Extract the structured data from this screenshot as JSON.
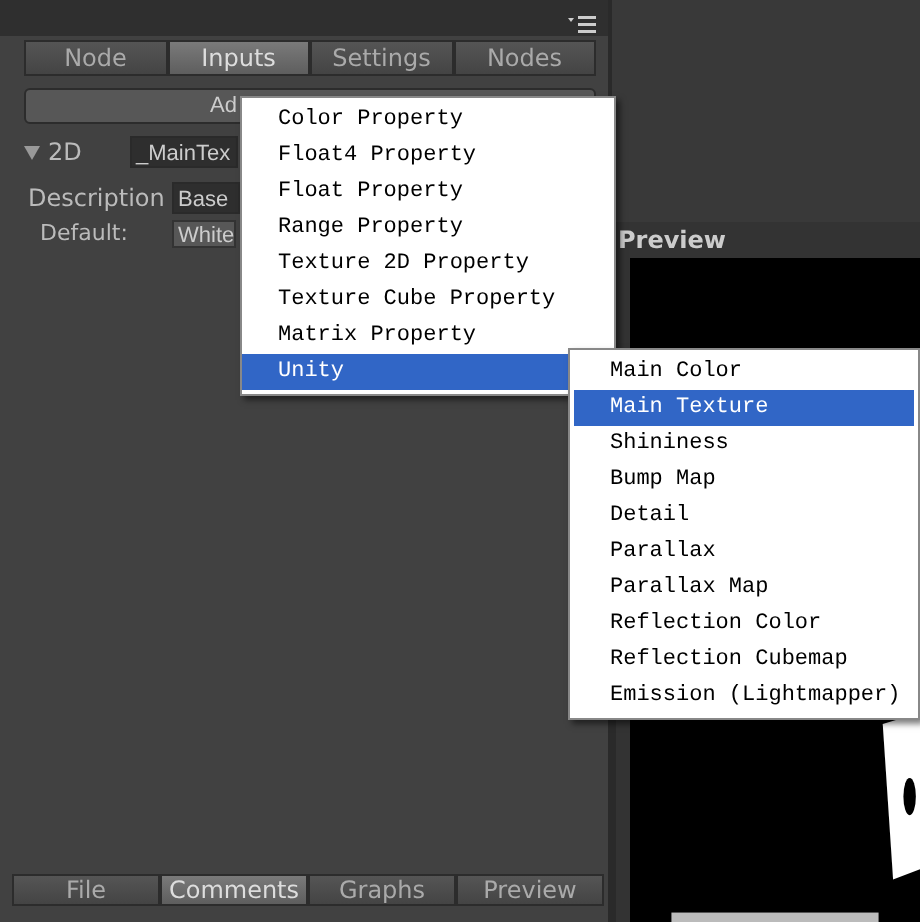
{
  "inspector": {
    "top_tabs": [
      {
        "label": "Node",
        "selected": false
      },
      {
        "label": "Inputs",
        "selected": true
      },
      {
        "label": "Settings",
        "selected": false
      },
      {
        "label": "Nodes",
        "selected": false
      }
    ],
    "add_button": "Ad",
    "property": {
      "type": "2D",
      "expanded": true,
      "name": "_MainTex",
      "description_label": "Description",
      "description": "Base",
      "default_label": "Default:",
      "default": "White"
    },
    "bottom_tabs": [
      {
        "label": "File",
        "selected": false
      },
      {
        "label": "Comments",
        "selected": true
      },
      {
        "label": "Graphs",
        "selected": false
      },
      {
        "label": "Preview",
        "selected": false
      }
    ]
  },
  "preview": {
    "title": "Preview",
    "kind": "picture"
  },
  "menu": {
    "items": [
      {
        "label": "Color Property",
        "selected": false,
        "has_submenu": false
      },
      {
        "label": "Float4 Property",
        "selected": false,
        "has_submenu": false
      },
      {
        "label": "Float Property",
        "selected": false,
        "has_submenu": false
      },
      {
        "label": "Range Property",
        "selected": false,
        "has_submenu": false
      },
      {
        "label": "Texture 2D Property",
        "selected": false,
        "has_submenu": false
      },
      {
        "label": "Texture Cube Property",
        "selected": false,
        "has_submenu": false
      },
      {
        "label": "Matrix Property",
        "selected": false,
        "has_submenu": false
      },
      {
        "label": "Unity",
        "selected": true,
        "has_submenu": true
      }
    ]
  },
  "submenu": {
    "items": [
      {
        "label": "Main Color",
        "selected": false
      },
      {
        "label": "Main Texture",
        "selected": true
      },
      {
        "label": "Shininess",
        "selected": false
      },
      {
        "label": "Bump Map",
        "selected": false
      },
      {
        "label": "Detail",
        "selected": false
      },
      {
        "label": "Parallax",
        "selected": false
      },
      {
        "label": "Parallax Map",
        "selected": false
      },
      {
        "label": "Reflection Color",
        "selected": false
      },
      {
        "label": "Reflection Cubemap",
        "selected": false
      },
      {
        "label": "Emission (Lightmapper)",
        "selected": false
      }
    ]
  }
}
